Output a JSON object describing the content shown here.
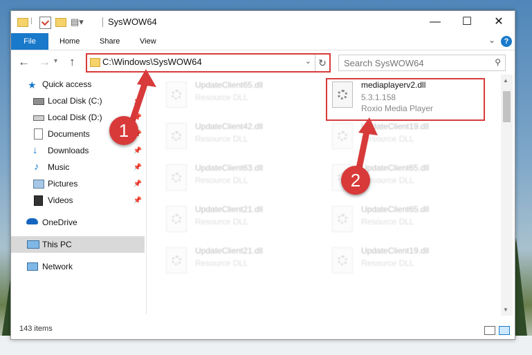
{
  "window": {
    "title": "SysWOW64"
  },
  "ribbon": {
    "file": "File",
    "home": "Home",
    "share": "Share",
    "view": "View",
    "help": "?"
  },
  "address": {
    "path": "C:\\Windows\\SysWOW64"
  },
  "search": {
    "placeholder": "Search SysWOW64"
  },
  "sidebar": {
    "quick_access": "Quick access",
    "local_c": "Local Disk (C:)",
    "local_d": "Local Disk (D:)",
    "documents": "Documents",
    "downloads": "Downloads",
    "music": "Music",
    "pictures": "Pictures",
    "videos": "Videos",
    "onedrive": "OneDrive",
    "this_pc": "This PC",
    "network": "Network"
  },
  "files": {
    "left": [
      {
        "name": "UpdateClient65.dll",
        "type": "Resource DLL"
      },
      {
        "name": "UpdateClient42.dll",
        "type": "Resource DLL"
      },
      {
        "name": "UpdateClient63.dll",
        "type": "Resource DLL"
      },
      {
        "name": "UpdateClient21.dll",
        "type": "Resource DLL"
      },
      {
        "name": "UpdateClient21.dll",
        "type": "Resource DLL"
      }
    ],
    "right": [
      {
        "name": "mediaplayerv2.dll",
        "version": "5.3.1.158",
        "company": "Roxio Media Player"
      },
      {
        "name": "UpdateClient19.dll",
        "type": "Resource DLL"
      },
      {
        "name": "UpdateClient65.dll",
        "type": "Resource DLL"
      },
      {
        "name": "UpdateClient65.dll",
        "type": "Resource DLL"
      },
      {
        "name": "UpdateClient19.dll",
        "type": "Resource DLL"
      }
    ]
  },
  "status": {
    "count": "143 items"
  },
  "annotations": {
    "step1": "1",
    "step2": "2"
  },
  "colors": {
    "accent": "#1979ca",
    "annotation_red": "#d83a3a",
    "folder_yellow": "#f6d26b"
  }
}
